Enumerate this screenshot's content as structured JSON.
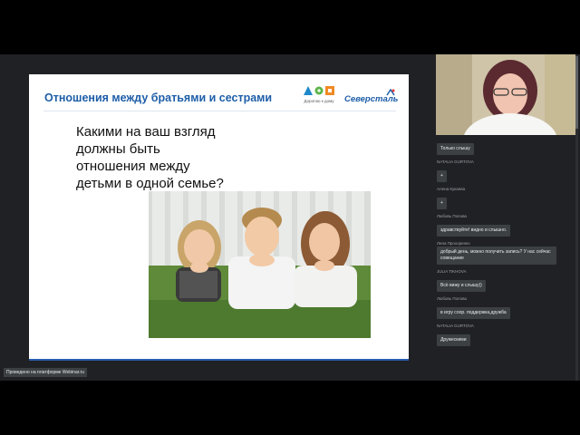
{
  "slide": {
    "title": "Отношения между братьями и сестрами",
    "question": "Какими на ваш взгляд должны быть отношения между детьми в одной семье?",
    "logo_road_caption": "Дорогою к дому",
    "logo_severstal": "Северсталь"
  },
  "chat": {
    "entries": [
      {
        "name": "",
        "message": "Только слышу"
      },
      {
        "name": "NATALIA GURTOVA",
        "message": "+"
      },
      {
        "name": "Алена Кукаева",
        "message": "+"
      },
      {
        "name": "Любовь Попова",
        "message": "здравствуйте! видно и слышно."
      },
      {
        "name": "Лена Прохоренко",
        "message": "добрый день, можно получить запись? У нас сейчас совещание"
      },
      {
        "name": "JULIA TIKHOVA",
        "message": "Всё вижу и слышу))"
      },
      {
        "name": "Любовь Попова",
        "message": "в игру соор. поддержка,дружба"
      },
      {
        "name": "NATALIA GURTOVA",
        "message": "Дружескими"
      }
    ]
  },
  "footer": {
    "platform_badge": "Проведено на платформе Webinar.ru"
  },
  "colors": {
    "slide_title": "#1e5ea8",
    "chat_bubble": "#3c4043",
    "background": "#202124"
  }
}
